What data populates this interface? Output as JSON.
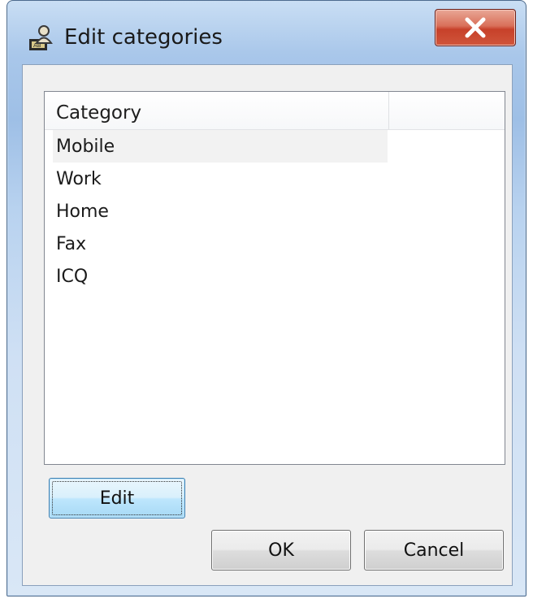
{
  "window": {
    "title": "Edit categories",
    "icon": "contacts-lock-icon",
    "close_icon": "close-icon",
    "close_label": "X"
  },
  "list": {
    "column_header": "Category",
    "items": [
      {
        "label": "Mobile",
        "selected": true
      },
      {
        "label": "Work",
        "selected": false
      },
      {
        "label": "Home",
        "selected": false
      },
      {
        "label": "Fax",
        "selected": false
      },
      {
        "label": "ICQ",
        "selected": false
      }
    ]
  },
  "buttons": {
    "edit_label": "Edit",
    "ok_label": "OK",
    "cancel_label": "Cancel"
  },
  "colors": {
    "titlebar": "#a9c7ea",
    "close_button": "#c7412a",
    "default_button": "#bee6fd",
    "selection": "#f2f2f2"
  }
}
